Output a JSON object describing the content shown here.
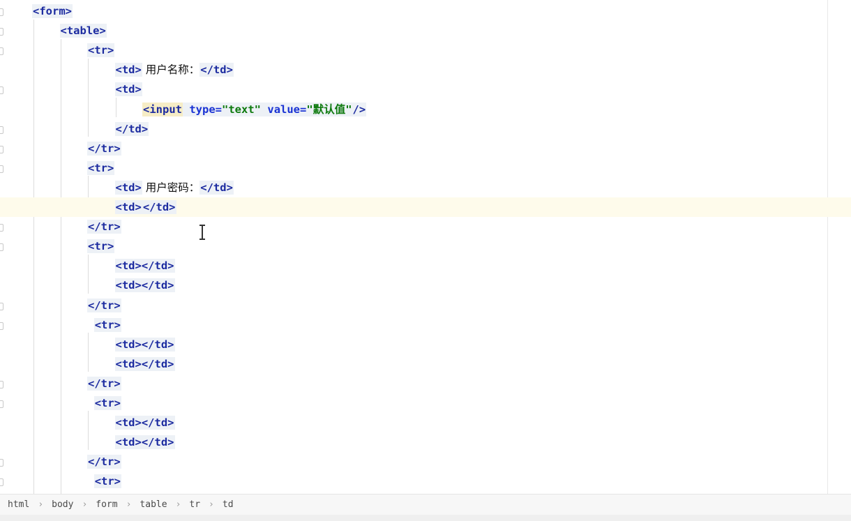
{
  "editor": {
    "lines": [
      {
        "indent": 0,
        "parts": [
          {
            "t": "tag",
            "v": "<form>"
          }
        ]
      },
      {
        "indent": 1,
        "parts": [
          {
            "t": "tag",
            "v": "<table>"
          }
        ]
      },
      {
        "indent": 2,
        "parts": [
          {
            "t": "tag",
            "v": "<tr>"
          }
        ]
      },
      {
        "indent": 3,
        "parts": [
          {
            "t": "tag",
            "v": "<td>"
          },
          {
            "t": "txt",
            "v": " 用户名称："
          },
          {
            "t": "tag",
            "v": "</td>"
          }
        ]
      },
      {
        "indent": 3,
        "parts": [
          {
            "t": "tag",
            "v": "<td>"
          }
        ]
      },
      {
        "indent": 4,
        "parts": [
          {
            "t": "input",
            "v": "<input"
          },
          {
            "t": "sp",
            "v": " "
          },
          {
            "t": "attr",
            "v": "type="
          },
          {
            "t": "str",
            "v": "\"text\""
          },
          {
            "t": "sp",
            "v": " "
          },
          {
            "t": "attr",
            "v": "value="
          },
          {
            "t": "str",
            "v": "\"默认值\""
          },
          {
            "t": "tag",
            "v": "/>"
          }
        ]
      },
      {
        "indent": 3,
        "parts": [
          {
            "t": "tag",
            "v": "</td>"
          }
        ]
      },
      {
        "indent": 2,
        "parts": [
          {
            "t": "tag",
            "v": "</tr>"
          }
        ]
      },
      {
        "indent": 2,
        "parts": [
          {
            "t": "tag",
            "v": "<tr>"
          }
        ]
      },
      {
        "indent": 3,
        "parts": [
          {
            "t": "tag",
            "v": "<td>"
          },
          {
            "t": "txt",
            "v": " 用户密码："
          },
          {
            "t": "tag",
            "v": "</td>"
          }
        ]
      },
      {
        "indent": 3,
        "current": true,
        "parts": [
          {
            "t": "tag",
            "v": "<td>"
          },
          {
            "t": "caret",
            "v": ""
          },
          {
            "t": "tag",
            "v": "</td>"
          }
        ]
      },
      {
        "indent": 2,
        "parts": [
          {
            "t": "tag",
            "v": "</tr>"
          }
        ]
      },
      {
        "indent": 2,
        "parts": [
          {
            "t": "tag",
            "v": "<tr>"
          }
        ]
      },
      {
        "indent": 3,
        "parts": [
          {
            "t": "tag",
            "v": "<td></td>"
          }
        ]
      },
      {
        "indent": 3,
        "parts": [
          {
            "t": "tag",
            "v": "<td></td>"
          }
        ]
      },
      {
        "indent": 2,
        "parts": [
          {
            "t": "tag",
            "v": "</tr>"
          }
        ]
      },
      {
        "indent": 2,
        "extra": 1,
        "parts": [
          {
            "t": "tag",
            "v": "<tr>"
          }
        ]
      },
      {
        "indent": 3,
        "parts": [
          {
            "t": "tag",
            "v": "<td></td>"
          }
        ]
      },
      {
        "indent": 3,
        "parts": [
          {
            "t": "tag",
            "v": "<td></td>"
          }
        ]
      },
      {
        "indent": 2,
        "parts": [
          {
            "t": "tag",
            "v": "</tr>"
          }
        ]
      },
      {
        "indent": 2,
        "extra": 1,
        "parts": [
          {
            "t": "tag",
            "v": "<tr>"
          }
        ]
      },
      {
        "indent": 3,
        "parts": [
          {
            "t": "tag",
            "v": "<td></td>"
          }
        ]
      },
      {
        "indent": 3,
        "parts": [
          {
            "t": "tag",
            "v": "<td></td>"
          }
        ]
      },
      {
        "indent": 2,
        "parts": [
          {
            "t": "tag",
            "v": "</tr>"
          }
        ]
      },
      {
        "indent": 2,
        "extra": 1,
        "parts": [
          {
            "t": "tag",
            "v": "<tr>"
          }
        ]
      }
    ],
    "fold_rows": [
      0,
      1,
      2,
      4,
      6,
      7,
      8,
      11,
      12,
      15,
      16,
      19,
      20,
      23,
      24
    ]
  },
  "breadcrumb": {
    "items": [
      "html",
      "body",
      "form",
      "table",
      "tr",
      "td"
    ]
  }
}
